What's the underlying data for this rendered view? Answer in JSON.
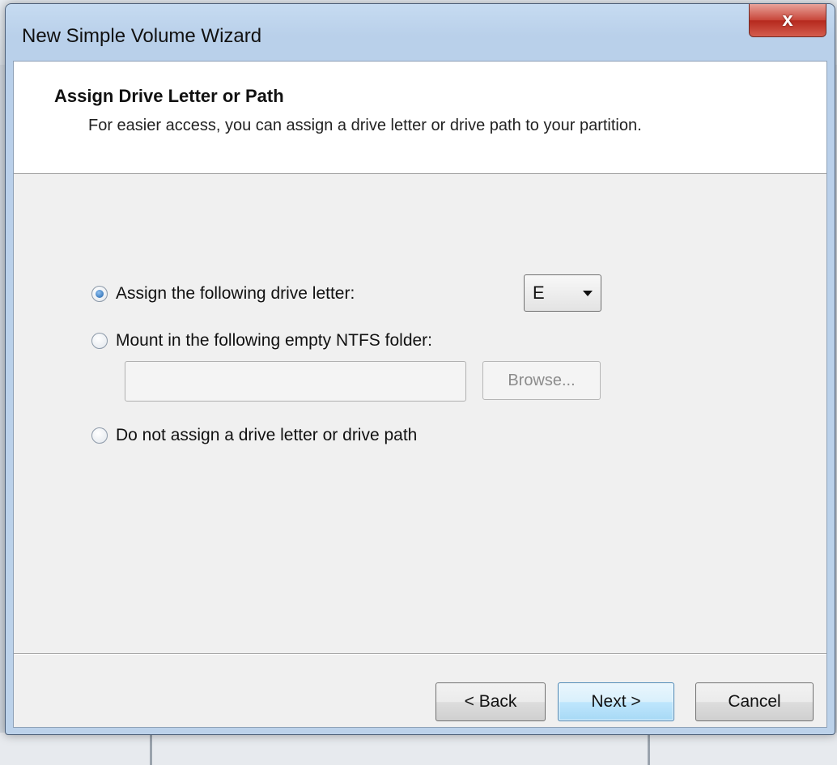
{
  "window": {
    "title": "New Simple Volume Wizard",
    "close_glyph": "x"
  },
  "header": {
    "title": "Assign Drive Letter or Path",
    "subtitle": "For easier access, you can assign a drive letter or drive path to your partition."
  },
  "options": {
    "assign_letter": {
      "label": "Assign the following drive letter:",
      "checked": true
    },
    "mount_folder": {
      "label": "Mount in the following empty NTFS folder:",
      "checked": false
    },
    "no_assign": {
      "label": "Do not assign a drive letter or drive path",
      "checked": false
    }
  },
  "drive_letter": {
    "selected": "E"
  },
  "folder_path": {
    "value": ""
  },
  "browse_label": "Browse...",
  "footer": {
    "back_label": "< Back",
    "next_label": "Next >",
    "cancel_label": "Cancel"
  },
  "colors": {
    "accent": "#3c7fb1",
    "close_button": "#c8463a",
    "title_bar": "#bcd2ea"
  }
}
